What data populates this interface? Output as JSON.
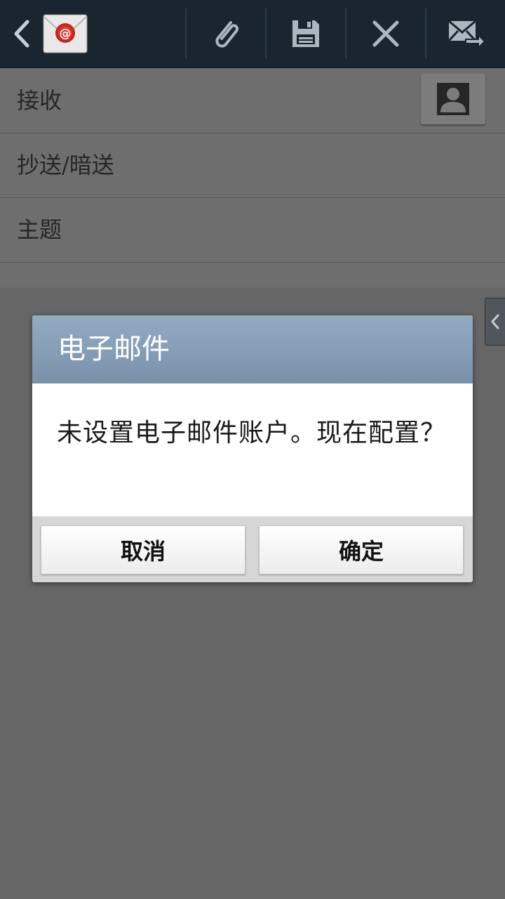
{
  "toolbar": {
    "back_icon": "chevron-left-icon",
    "app_icon": "email-envelope-icon",
    "attach_icon": "paperclip-icon",
    "save_icon": "save-disk-icon",
    "discard_icon": "close-x-icon",
    "send_icon": "send-mail-icon"
  },
  "compose": {
    "to_label": "接收",
    "cc_bcc_label": "抄送/暗送",
    "subject_label": "主题",
    "contact_icon": "contact-person-icon"
  },
  "dialog": {
    "title": "电子邮件",
    "message": "未设置电子邮件账户。现在配置？",
    "cancel_label": "取消",
    "ok_label": "确定"
  },
  "colors": {
    "action_bar": "#1a2530",
    "dialog_title": "#8aa3bb",
    "dim_overlay": "#6a6a6a"
  }
}
